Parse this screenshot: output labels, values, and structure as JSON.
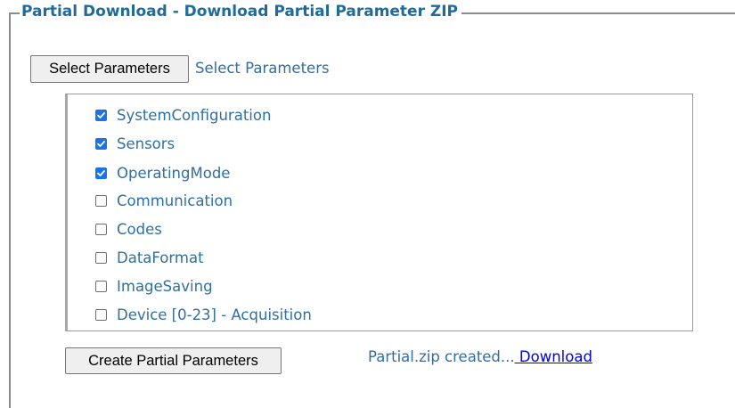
{
  "section": {
    "legend": "Partial Download - Download Partial Parameter ZIP"
  },
  "select": {
    "button_label": "Select Parameters",
    "link_label": "Select Parameters"
  },
  "parameters": [
    {
      "label": "SystemConfiguration",
      "checked": true
    },
    {
      "label": "Sensors",
      "checked": true
    },
    {
      "label": "OperatingMode",
      "checked": true
    },
    {
      "label": "Communication",
      "checked": false
    },
    {
      "label": "Codes",
      "checked": false
    },
    {
      "label": "DataFormat",
      "checked": false
    },
    {
      "label": "ImageSaving",
      "checked": false
    },
    {
      "label": "Device [0-23] - Acquisition",
      "checked": false
    }
  ],
  "actions": {
    "create_label": "Create Partial Parameters"
  },
  "status": {
    "message": "Partial.zip created...",
    "download_label": " Download"
  },
  "colors": {
    "accent": "#1f6b99",
    "text_link": "#2f6fa3",
    "checkbox_checked": "#1a73e8",
    "hyperlink": "#0000ee"
  }
}
